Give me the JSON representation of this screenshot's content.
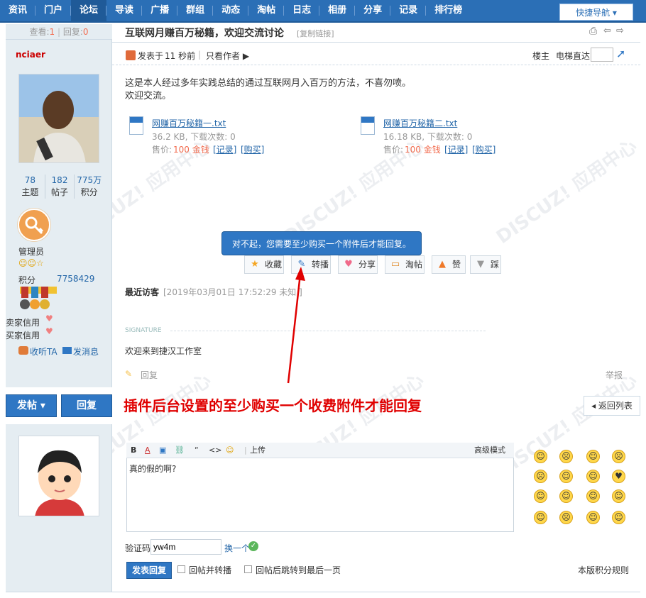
{
  "nav": {
    "items": [
      "资讯",
      "门户",
      "论坛",
      "导读",
      "广播",
      "群组",
      "动态",
      "淘帖",
      "日志",
      "相册",
      "分享",
      "记录",
      "排行榜"
    ],
    "quick": "快捷导航 ▾"
  },
  "thread": {
    "views_label": "查看:",
    "views": "1",
    "replies_label": "回复:",
    "replies": "0",
    "title": "互联网月赚百万秘籍，欢迎交流讨论",
    "copy_link": "[复制链接]"
  },
  "author": {
    "name": "nciaer",
    "stats": [
      {
        "num": "78",
        "label": "主题"
      },
      {
        "num": "182",
        "label": "帖子"
      },
      {
        "num": "775万",
        "label": "积分"
      }
    ],
    "group": "管理员",
    "points_label": "积分",
    "points": "7758429",
    "seller_credit": "卖家信用",
    "buyer_credit": "买家信用",
    "follow": "收听TA",
    "message": "发消息"
  },
  "post": {
    "posted_label": "发表于",
    "posted_time": "11 秒前",
    "only_author": "只看作者 ▶",
    "floor": "楼主",
    "goto_floor": "电梯直达",
    "line1": "这是本人经过多年实践总结的通过互联网月入百万的方法，不喜勿喷。",
    "line2": "欢迎交流。",
    "attachments": [
      {
        "name": "网赚百万秘籍一.txt",
        "meta": "36.2 KB, 下载次数: 0",
        "price_label": "售价:",
        "price": "100 金钱",
        "record": "[记录]",
        "buy": "[购买]"
      },
      {
        "name": "网赚百万秘籍二.txt",
        "meta": "16.18 KB, 下载次数: 0",
        "price_label": "售价:",
        "price": "100 金钱",
        "record": "[记录]",
        "buy": "[购买]"
      }
    ],
    "tooltip": "对不起，您需要至少购买一个附件后才能回复。",
    "actions": [
      "收藏",
      "转播",
      "分享",
      "淘帖",
      "赞",
      "踩"
    ],
    "recent_label": "最近访客",
    "recent_time": "[2019年03月01日 17:52:29 未知 ]",
    "signature_label": "SIGNATURE",
    "signature": "欢迎来到捷汉工作室",
    "reply_link": "回复",
    "report": "举报"
  },
  "bottom": {
    "post_btn": "发帖 ▾",
    "reply_btn": "回复",
    "banner": "插件后台设置的至少购买一个收费附件才能回复",
    "back": "◂ 返回列表"
  },
  "reply_form": {
    "toolbar_upload": "上传",
    "advanced": "高级模式",
    "content": "真的假的啊?",
    "captcha_label": "验证码",
    "captcha_value": "yw4m",
    "captcha_change": "换一个",
    "submit": "发表回复",
    "opt1": "回帖并转播",
    "opt2": "回帖后跳转到最后一页",
    "rules": "本版积分规则"
  },
  "colors": {
    "nav": "#2b6fb6",
    "accent": "#2f77c4",
    "banner": "#e00000",
    "price": "#f26c4f"
  }
}
